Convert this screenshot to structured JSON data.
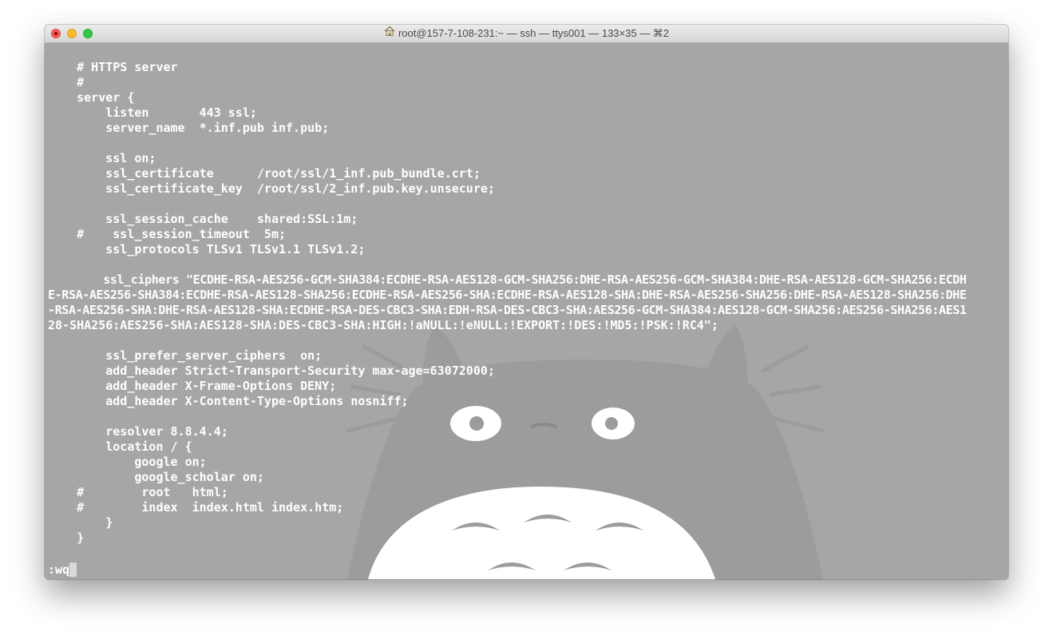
{
  "window": {
    "title": "root@157-7-108-231:~ — ssh — ttys001 — 133×35 — ⌘2",
    "icon": "home-icon"
  },
  "colors": {
    "terminal_bg": "#a6a6a6",
    "text": "#ffffff",
    "close": "#fc5b57",
    "minimize": "#fdbc2e",
    "maximize": "#33c748"
  },
  "editor": {
    "lines": [
      "    # HTTPS server",
      "    #",
      "    server {",
      "        listen       443 ssl;",
      "        server_name  *.inf.pub inf.pub;",
      "",
      "        ssl on;",
      "        ssl_certificate      /root/ssl/1_inf.pub_bundle.crt;",
      "        ssl_certificate_key  /root/ssl/2_inf.pub.key.unsecure;",
      "",
      "        ssl_session_cache    shared:SSL:1m;",
      "    #    ssl_session_timeout  5m;",
      "        ssl_protocols TLSv1 TLSv1.1 TLSv1.2;",
      "",
      "        ssl_ciphers \"ECDHE-RSA-AES256-GCM-SHA384:ECDHE-RSA-AES128-GCM-SHA256:DHE-RSA-AES256-GCM-SHA384:DHE-RSA-AES128-GCM-SHA256:ECDH",
      "E-RSA-AES256-SHA384:ECDHE-RSA-AES128-SHA256:ECDHE-RSA-AES256-SHA:ECDHE-RSA-AES128-SHA:DHE-RSA-AES256-SHA256:DHE-RSA-AES128-SHA256:DHE",
      "-RSA-AES256-SHA:DHE-RSA-AES128-SHA:ECDHE-RSA-DES-CBC3-SHA:EDH-RSA-DES-CBC3-SHA:AES256-GCM-SHA384:AES128-GCM-SHA256:AES256-SHA256:AES1",
      "28-SHA256:AES256-SHA:AES128-SHA:DES-CBC3-SHA:HIGH:!aNULL:!eNULL:!EXPORT:!DES:!MD5:!PSK:!RC4\";",
      "",
      "        ssl_prefer_server_ciphers  on;",
      "        add_header Strict-Transport-Security max-age=63072000;",
      "        add_header X-Frame-Options DENY;",
      "        add_header X-Content-Type-Options nosniff;",
      "",
      "        resolver 8.8.4.4;",
      "        location / {",
      "            google on;",
      "            google_scholar on;",
      "    #        root   html;",
      "    #        index  index.html index.htm;",
      "        }",
      "    }"
    ],
    "command": ":wq"
  }
}
